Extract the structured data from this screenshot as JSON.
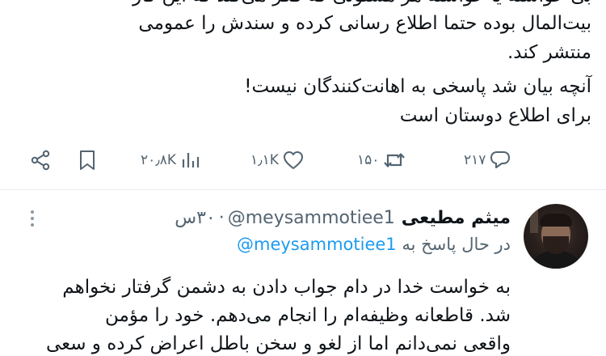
{
  "first_tweet": {
    "lines": [
      "بیت‌المال بوده حتما اطلاع رسانی کرده و سندش را عمومی",
      "منتشر کند.",
      "آنچه بیان شد پاسخی به اهانت‌کنندگان نیست!",
      "برای اطلاع دوستان است"
    ],
    "clipped_line": "ﺑﯽ ﺧﻮاﺳﺘﻪ ﻳﺎ ﺧﻮاﺳﺘﻪ ﻫﺮ ﻣﺴﺌﻮﻟﯽ ﻛﻪ ﻓﻜﺮ ﻣﯽ‌ﻛﻨﺪ ﻛﻪ اﻳﻦ ﻛﺎر",
    "actions": {
      "replies": "۲۱۷",
      "retweets": "۱۵۰",
      "likes": "۱٫۱K",
      "views": "۲۰٫۸K"
    }
  },
  "reply_tweet": {
    "author_name": "میثم مطیعی",
    "handle": "@meysammotiee1",
    "time": "۳۰س",
    "replying_prefix": "در حال پاسخ به",
    "replying_to": "@meysammotiee1",
    "lines": [
      "به خواست خدا در دام جواب دادن به دشمن گرفتار نخواهم",
      "شد. قاطعانه وظیفه‌ام را انجام می‌دهم. خود را مؤمن",
      "واقعی نمی‌دانم اما از لغو و سخن باطل اعراض کرده و سعی"
    ]
  },
  "colors": {
    "text": "#0f1419",
    "muted": "#536471",
    "link": "#1d9bf0"
  },
  "icons": [
    "share-icon",
    "bookmark-icon",
    "views-icon",
    "like-icon",
    "retweet-icon",
    "reply-icon",
    "more-icon",
    "avatar"
  ]
}
